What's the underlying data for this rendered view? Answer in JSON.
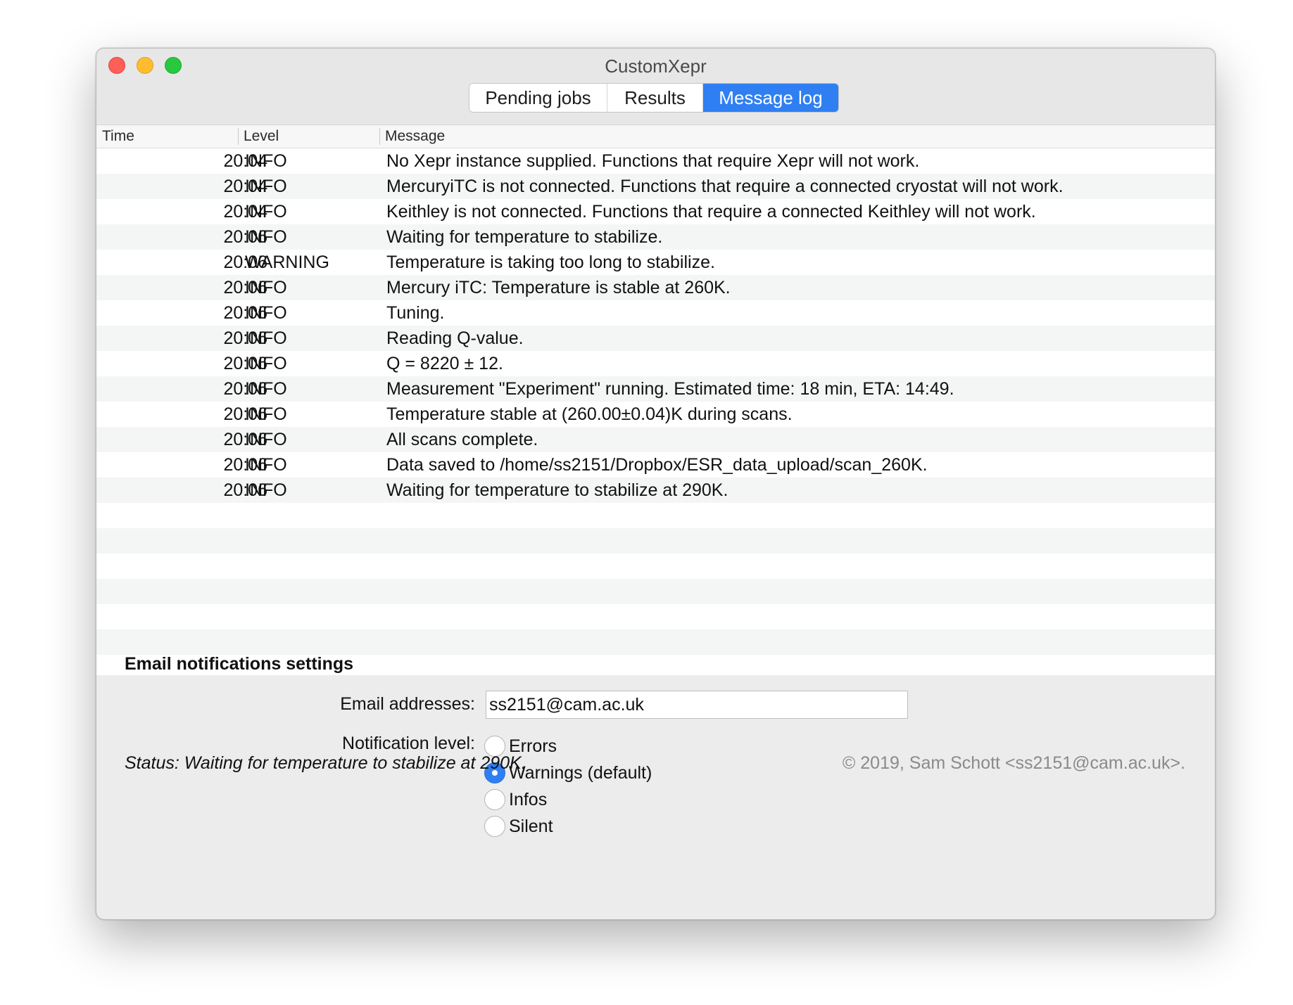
{
  "window": {
    "title": "CustomXepr"
  },
  "tabs": [
    {
      "label": "Pending jobs",
      "active": false
    },
    {
      "label": "Results",
      "active": false
    },
    {
      "label": "Message log",
      "active": true
    }
  ],
  "log_table": {
    "columns": [
      "Time",
      "Level",
      "Message"
    ],
    "rows": [
      {
        "time": "20:04",
        "level": "INFO",
        "message": "No Xepr instance supplied. Functions that require Xepr will not work."
      },
      {
        "time": "20:04",
        "level": "INFO",
        "message": "MercuryiTC is not connected. Functions that require a connected cryostat will not work."
      },
      {
        "time": "20:04",
        "level": "INFO",
        "message": "Keithley is not connected. Functions that require a connected Keithley will not work."
      },
      {
        "time": "20:06",
        "level": "INFO",
        "message": "Waiting for temperature to stabilize."
      },
      {
        "time": "20:06",
        "level": "WARNING",
        "message": "Temperature is taking too long to stabilize."
      },
      {
        "time": "20:06",
        "level": "INFO",
        "message": "Mercury iTC: Temperature is stable at 260K."
      },
      {
        "time": "20:06",
        "level": "INFO",
        "message": "Tuning."
      },
      {
        "time": "20:06",
        "level": "INFO",
        "message": "Reading Q-value."
      },
      {
        "time": "20:06",
        "level": "INFO",
        "message": "Q = 8220 ± 12."
      },
      {
        "time": "20:06",
        "level": "INFO",
        "message": "Measurement \"Experiment\" running. Estimated time: 18 min, ETA: 14:49."
      },
      {
        "time": "20:06",
        "level": "INFO",
        "message": "Temperature stable at (260.00±0.04)K during scans."
      },
      {
        "time": "20:06",
        "level": "INFO",
        "message": "All scans complete."
      },
      {
        "time": "20:06",
        "level": "INFO",
        "message": "Data saved to /home/ss2151/Dropbox/ESR_data_upload/scan_260K."
      },
      {
        "time": "20:06",
        "level": "INFO",
        "message": "Waiting for temperature to stabilize at 290K."
      }
    ]
  },
  "settings": {
    "title": "Email notifications settings",
    "email_label": "Email addresses:",
    "email_value": "ss2151@cam.ac.uk",
    "notification_label": "Notification level:",
    "notification_options": [
      {
        "label": "Errors",
        "selected": false
      },
      {
        "label": "Warnings (default)",
        "selected": true
      },
      {
        "label": "Infos",
        "selected": false
      },
      {
        "label": "Silent",
        "selected": false
      }
    ]
  },
  "footer": {
    "status": "Status: Waiting for temperature to stabilize at 290K.",
    "copyright": "© 2019, Sam Schott <ss2151@cam.ac.uk>."
  },
  "colors": {
    "accent": "#2f7ff3",
    "close": "#ff5f57",
    "minimize": "#febc2e",
    "maximize": "#28c840"
  }
}
